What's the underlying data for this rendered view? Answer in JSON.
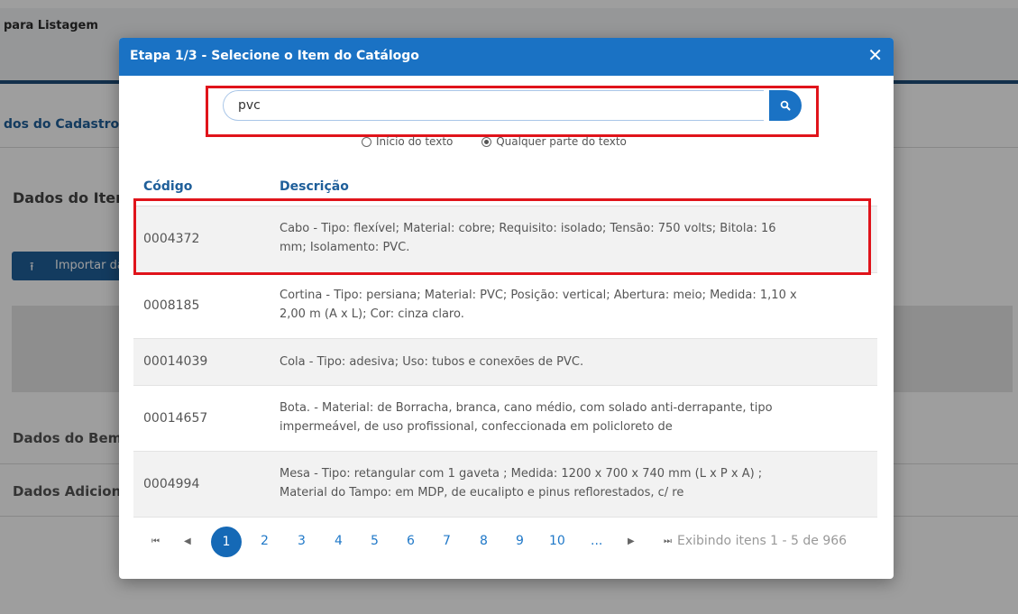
{
  "background": {
    "header_title": "para Listagem",
    "section_link": "dos do Cadastro",
    "section_title_1": "Dados do Item",
    "import_button": "Importar dados",
    "section_title_2": "Dados do Bem",
    "section_title_3": "Dados Adicionais"
  },
  "modal": {
    "title": "Etapa 1/3 - Selecione o Item do Catálogo",
    "close_label": "✕",
    "search": {
      "value": "pvc",
      "placeholder": ""
    },
    "radio_options": [
      {
        "label": "Início do texto",
        "selected": false
      },
      {
        "label": "Qualquer parte do texto",
        "selected": true
      }
    ],
    "table": {
      "headers": {
        "code": "Código",
        "description": "Descrição"
      },
      "rows": [
        {
          "code": "0004372",
          "line1": "Cabo - Tipo: flexível; Material: cobre; Requisito: isolado; Tensão: 750 volts; Bitola: 16",
          "line2": "mm; Isolamento: PVC."
        },
        {
          "code": "0008185",
          "line1": "Cortina - Tipo: persiana; Material: PVC; Posição: vertical; Abertura: meio; Medida: 1,10 x",
          "line2": "2,00 m (A x L); Cor: cinza claro."
        },
        {
          "code": "00014039",
          "line1": "Cola - Tipo: adesiva; Uso: tubos e conexões de PVC.",
          "line2": ""
        },
        {
          "code": "00014657",
          "line1": "Bota. - Material: de Borracha, branca, cano médio, com solado anti-derrapante, tipo",
          "line2": "impermeável, de uso profissional, confeccionada em policloreto de"
        },
        {
          "code": "0004994",
          "line1": "Mesa - Tipo: retangular com 1 gaveta ; Medida: 1200 x 700 x 740 mm (L x P x A) ;",
          "line2": "Material do Tampo: em MDP, de eucalipto e pinus reflorestados, c/ re"
        }
      ]
    },
    "pager": {
      "current": "1",
      "pages": [
        "2",
        "3",
        "4",
        "5",
        "6",
        "7",
        "8",
        "9",
        "10",
        "..."
      ],
      "info": "Exibindo itens 1 - 5 de 966"
    }
  },
  "colors": {
    "header_blue": "#1a72c4",
    "highlight_red": "#e0141b",
    "link_blue": "#1f78c8"
  },
  "icons": [
    "search-icon",
    "close-icon",
    "upload-icon",
    "first-page-icon",
    "prev-page-icon",
    "next-page-icon",
    "last-page-icon"
  ]
}
